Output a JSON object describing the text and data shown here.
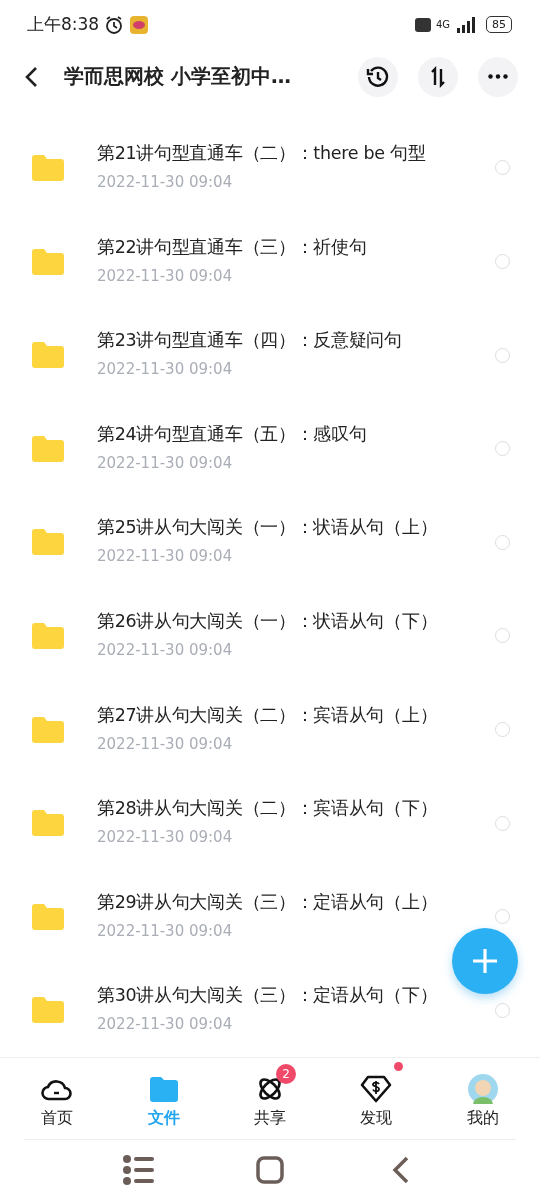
{
  "status_bar": {
    "time": "上午8:38",
    "network": "4G",
    "battery": "85"
  },
  "header": {
    "title": "学而思网校  小学至初中…"
  },
  "files": [
    {
      "name": "第21讲句型直通车（二）：there be 句型",
      "date": "2022-11-30  09:04",
      "selected": false
    },
    {
      "name": "第22讲句型直通车（三）：祈使句",
      "date": "2022-11-30  09:04",
      "selected": false
    },
    {
      "name": "第23讲句型直通车（四）：反意疑问句",
      "date": "2022-11-30  09:04",
      "selected": false
    },
    {
      "name": "第24讲句型直通车（五）：感叹句",
      "date": "2022-11-30  09:04",
      "selected": false
    },
    {
      "name": "第25讲从句大闯关（一）：状语从句（上）",
      "date": "2022-11-30  09:04",
      "selected": false
    },
    {
      "name": "第26讲从句大闯关（一）：状语从句（下）",
      "date": "2022-11-30  09:04",
      "selected": false
    },
    {
      "name": "第27讲从句大闯关（二）：宾语从句（上）",
      "date": "2022-11-30  09:04",
      "selected": false
    },
    {
      "name": "第28讲从句大闯关（二）：宾语从句（下）",
      "date": "2022-11-30  09:04",
      "selected": false
    },
    {
      "name": "第29讲从句大闯关（三）：定语从句（上）",
      "date": "2022-11-30  09:04",
      "selected": false
    },
    {
      "name": "第30讲从句大闯关（三）：定语从句（下）",
      "date": "2022-11-30  09:04",
      "selected": false
    }
  ],
  "tabs": [
    {
      "kind": "home",
      "label": "首页",
      "selected": false
    },
    {
      "kind": "files",
      "label": "文件",
      "selected": true
    },
    {
      "kind": "share",
      "label": "共享",
      "selected": false,
      "badge": "2"
    },
    {
      "kind": "discover",
      "label": "发现",
      "selected": false,
      "dot": true
    },
    {
      "kind": "me",
      "label": "我的",
      "selected": false
    }
  ]
}
